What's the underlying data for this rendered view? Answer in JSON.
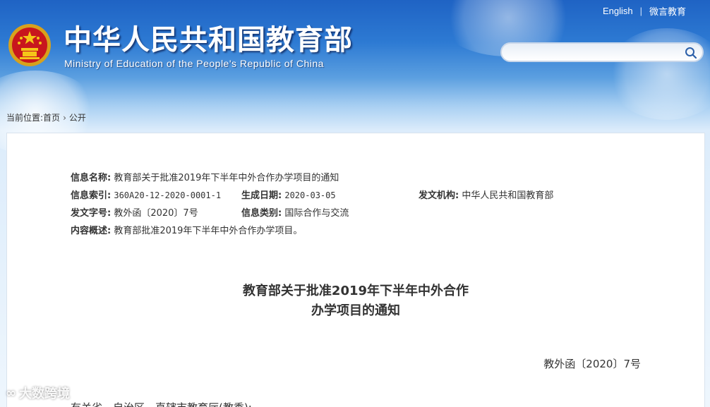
{
  "header": {
    "title_cn": "中华人民共和国教育部",
    "title_en": "Ministry of Education of the People's Republic of China",
    "links": [
      "English",
      "微言教育"
    ],
    "search": {
      "value": "",
      "placeholder": ""
    }
  },
  "breadcrumb": {
    "prefix": "当前位置:",
    "items": [
      "首页",
      "公开"
    ]
  },
  "meta": {
    "name_label": "信息名称:",
    "name_value": "教育部关于批准2019年下半年中外合作办学项目的通知",
    "index_label": "信息索引:",
    "index_value": "360A20-12-2020-0001-1",
    "date_label": "生成日期:",
    "date_value": "2020-03-05",
    "issuer_label": "发文机构:",
    "issuer_value": "中华人民共和国教育部",
    "docno_label": "发文字号:",
    "docno_value": "教外函〔2020〕7号",
    "category_label": "信息类别:",
    "category_value": "国际合作与交流",
    "summary_label": "内容概述:",
    "summary_value": "教育部批准2019年下半年中外合作办学项目。"
  },
  "document": {
    "title_line1": "教育部关于批准2019年下半年中外合作",
    "title_line2": "办学项目的通知",
    "number": "教外函〔2020〕7号",
    "salutation": "有关省、自治区、直辖市教育厅(教委):"
  },
  "watermark": {
    "text": "大数跨境"
  },
  "colors": {
    "header_blue": "#1f63c4",
    "text": "#333333",
    "panel_border": "#d9e3ee"
  }
}
